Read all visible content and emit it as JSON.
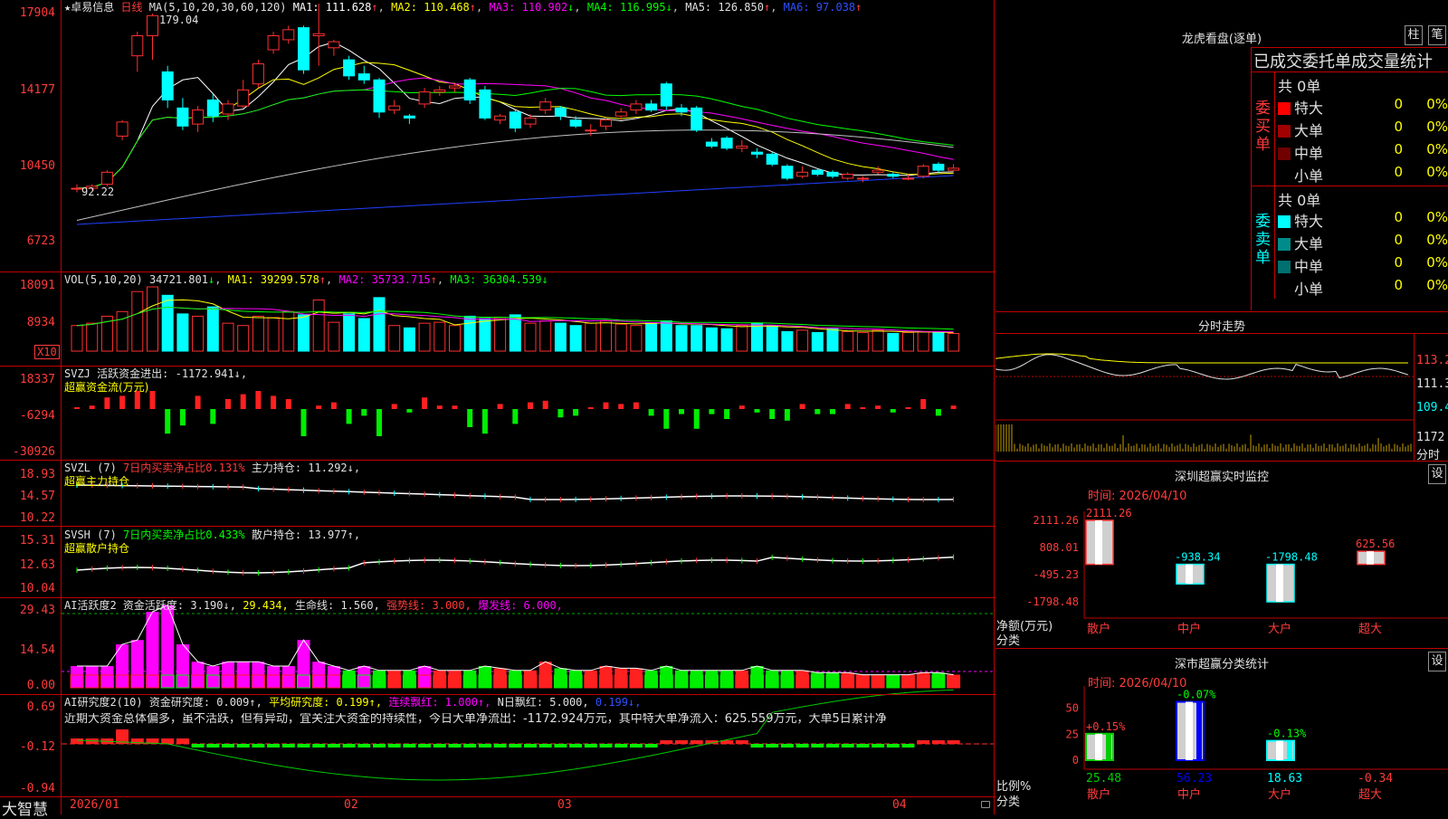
{
  "main_chart": {
    "star_mark": "★",
    "stock_name": "卓易信息",
    "period": "日线",
    "ma_legend": "MA(5,10,20,30,60,120)",
    "ma": [
      {
        "label": "MA1: 111.628",
        "arrow": "↑",
        "color": "#ffffff"
      },
      {
        "label": "MA2: 110.468",
        "arrow": "↑",
        "color": "#ffff00"
      },
      {
        "label": "MA3: 110.902",
        "arrow": "↓",
        "color": "#ff00ff"
      },
      {
        "label": "MA4: 116.995",
        "arrow": "↓",
        "color": "#00ff00"
      },
      {
        "label": "MA5: 126.850",
        "arrow": "↑",
        "color": "#c0c0c0"
      },
      {
        "label": "MA6: 97.038",
        "arrow": "↑",
        "color": "#3050ff"
      }
    ],
    "y_labels": [
      "17904",
      "14177",
      "10450",
      "6723"
    ],
    "high_annotation": "179.04",
    "low_annotation": "92.22",
    "candles": [
      {
        "o": 92,
        "c": 92,
        "h": 94,
        "l": 90
      },
      {
        "o": 92,
        "c": 93,
        "h": 94,
        "l": 91
      },
      {
        "o": 94,
        "c": 100,
        "h": 101,
        "l": 93
      },
      {
        "o": 118,
        "c": 125,
        "h": 126,
        "l": 116
      },
      {
        "o": 158,
        "c": 168,
        "h": 170,
        "l": 150
      },
      {
        "o": 168,
        "c": 178,
        "h": 179,
        "l": 156
      },
      {
        "o": 150,
        "c": 136,
        "h": 153,
        "l": 132
      },
      {
        "o": 132,
        "c": 123,
        "h": 137,
        "l": 121
      },
      {
        "o": 124,
        "c": 131,
        "h": 133,
        "l": 120
      },
      {
        "o": 136,
        "c": 128,
        "h": 139,
        "l": 125
      },
      {
        "o": 129,
        "c": 134,
        "h": 136,
        "l": 126
      },
      {
        "o": 133,
        "c": 141,
        "h": 146,
        "l": 132
      },
      {
        "o": 144,
        "c": 154,
        "h": 156,
        "l": 142
      },
      {
        "o": 161,
        "c": 168,
        "h": 170,
        "l": 159
      },
      {
        "o": 166,
        "c": 171,
        "h": 173,
        "l": 164
      },
      {
        "o": 172,
        "c": 151,
        "h": 173,
        "l": 149
      },
      {
        "o": 168,
        "c": 169,
        "h": 184,
        "l": 153
      },
      {
        "o": 162,
        "c": 165,
        "h": 166,
        "l": 158
      },
      {
        "o": 156,
        "c": 148,
        "h": 158,
        "l": 146
      },
      {
        "o": 149,
        "c": 146,
        "h": 153,
        "l": 144
      },
      {
        "o": 146,
        "c": 130,
        "h": 147,
        "l": 127
      },
      {
        "o": 131,
        "c": 133,
        "h": 136,
        "l": 129
      },
      {
        "o": 128,
        "c": 127,
        "h": 129,
        "l": 124
      },
      {
        "o": 134,
        "c": 140,
        "h": 142,
        "l": 132
      },
      {
        "o": 140,
        "c": 141,
        "h": 143,
        "l": 138
      },
      {
        "o": 142,
        "c": 143,
        "h": 144,
        "l": 140
      },
      {
        "o": 146,
        "c": 136,
        "h": 147,
        "l": 134
      },
      {
        "o": 141,
        "c": 127,
        "h": 143,
        "l": 126
      },
      {
        "o": 126,
        "c": 128,
        "h": 129,
        "l": 124
      },
      {
        "o": 130,
        "c": 122,
        "h": 131,
        "l": 120
      },
      {
        "o": 124,
        "c": 127,
        "h": 129,
        "l": 122
      },
      {
        "o": 131,
        "c": 135,
        "h": 137,
        "l": 129
      },
      {
        "o": 132,
        "c": 128,
        "h": 133,
        "l": 126
      },
      {
        "o": 126,
        "c": 123,
        "h": 128,
        "l": 122
      },
      {
        "o": 121,
        "c": 121,
        "h": 124,
        "l": 118
      },
      {
        "o": 123,
        "c": 126,
        "h": 127,
        "l": 121
      },
      {
        "o": 128,
        "c": 130,
        "h": 132,
        "l": 126
      },
      {
        "o": 131,
        "c": 134,
        "h": 136,
        "l": 129
      },
      {
        "o": 134,
        "c": 131,
        "h": 136,
        "l": 130
      },
      {
        "o": 144,
        "c": 133,
        "h": 145,
        "l": 131
      },
      {
        "o": 132,
        "c": 130,
        "h": 134,
        "l": 128
      },
      {
        "o": 132,
        "c": 121,
        "h": 133,
        "l": 120
      },
      {
        "o": 115,
        "c": 113,
        "h": 117,
        "l": 112
      },
      {
        "o": 117,
        "c": 112,
        "h": 118,
        "l": 111
      },
      {
        "o": 112,
        "c": 113,
        "h": 116,
        "l": 110
      },
      {
        "o": 110,
        "c": 109,
        "h": 112,
        "l": 107
      },
      {
        "o": 109,
        "c": 104,
        "h": 110,
        "l": 103
      },
      {
        "o": 103,
        "c": 97,
        "h": 104,
        "l": 96
      },
      {
        "o": 98,
        "c": 100,
        "h": 103,
        "l": 97
      },
      {
        "o": 101,
        "c": 99,
        "h": 102,
        "l": 98
      },
      {
        "o": 100,
        "c": 98,
        "h": 101,
        "l": 97
      },
      {
        "o": 97,
        "c": 99,
        "h": 100,
        "l": 96
      },
      {
        "o": 97,
        "c": 97,
        "h": 98,
        "l": 95
      },
      {
        "o": 100,
        "c": 101,
        "h": 103,
        "l": 99
      },
      {
        "o": 99,
        "c": 98,
        "h": 100,
        "l": 97
      },
      {
        "o": 97,
        "c": 97,
        "h": 99,
        "l": 96
      },
      {
        "o": 98,
        "c": 103,
        "h": 104,
        "l": 97
      },
      {
        "o": 104,
        "c": 101,
        "h": 105,
        "l": 100
      },
      {
        "o": 101,
        "c": 102,
        "h": 104,
        "l": 100
      }
    ]
  },
  "vol_panel": {
    "legend": "VOL(5,10,20)",
    "value": "34721.801",
    "value_arrow": "↓",
    "ma": [
      {
        "label": "MA1: 39299.578",
        "arrow": "↑",
        "color": "#ffff00"
      },
      {
        "label": "MA2: 35733.715",
        "arrow": "↑",
        "color": "#ff00ff"
      },
      {
        "label": "MA3: 36304.539",
        "arrow": "↓",
        "color": "#00ff00"
      }
    ],
    "y_labels": [
      "18091",
      "8934"
    ],
    "multiplier": "X10",
    "bars": [
      55,
      60,
      75,
      85,
      128,
      138,
      120,
      80,
      75,
      95,
      60,
      55,
      75,
      72,
      85,
      78,
      110,
      62,
      80,
      70,
      115,
      55,
      50,
      60,
      62,
      55,
      75,
      70,
      72,
      78,
      60,
      65,
      60,
      55,
      60,
      65,
      58,
      55,
      60,
      65,
      55,
      55,
      50,
      48,
      55,
      60,
      55,
      42,
      45,
      40,
      48,
      42,
      40,
      45,
      38,
      40,
      42,
      40,
      38
    ]
  },
  "svzj_panel": {
    "legend": "SVZJ",
    "desc": "活跃资金进出: -1172.941↓,",
    "sub": "超赢资金流(万元)",
    "y_labels": [
      "18337",
      "-6294",
      "-30926"
    ]
  },
  "svzl_panel": {
    "legend": "SVZL (7)",
    "desc1": "7日内买卖净占比0.131%",
    "desc2": "主力持仓: 11.292↓,",
    "sub": "超赢主力持仓",
    "y_labels": [
      "18.93",
      "14.57",
      "10.22"
    ]
  },
  "svsh_panel": {
    "legend": "SVSH (7)",
    "desc1": "7日内买卖净占比0.433%",
    "desc2": "散户持仓: 13.977↑,",
    "sub": "超赢散户持仓",
    "y_labels": [
      "15.31",
      "12.63",
      "10.04"
    ]
  },
  "ai1_panel": {
    "legend": "AI活跃度2",
    "p1": "资金活跃度: 3.190↓,",
    "p2": "29.434,",
    "p3": "生命线: 1.560,",
    "p4": "强势线: 3.000,",
    "p5": "爆发线: 6.000,",
    "y_labels": [
      "29.43",
      "14.54",
      "0.00"
    ]
  },
  "ai2_panel": {
    "legend": "AI研究度2(10)",
    "p1": "资金研究度: 0.009↑,",
    "p2": "平均研究度: 0.199↑,",
    "p3": "连续飘红: 1.000↑,",
    "p4": "N日飘红: 5.000,",
    "p5": "0.199↓,",
    "commentary": "近期大资金总体偏多，虽不活跃，但有异动，宜关注大资金的持续性，今日大单净流出：-1172.924万元，其中特大单净流入：625.559万元，大单5日累计净",
    "y_labels": [
      "0.69",
      "-0.12",
      "-0.94"
    ]
  },
  "x_axis": {
    "brand": "大智慧",
    "labels": [
      "2026/01",
      "02",
      "03",
      "04"
    ]
  },
  "longhu": {
    "title": "龙虎看盘(逐单)",
    "btn1": "柱",
    "btn2": "笔",
    "header": "已成交委托单成交量统计",
    "buy_label": "委买单",
    "sell_label": "委卖单",
    "buy_total": "共 0单",
    "sell_total": "共 0单",
    "buy_rows": [
      {
        "name": "特大",
        "color": "#ff0000",
        "v": "0",
        "p": "0%"
      },
      {
        "name": "大单",
        "color": "#a00000",
        "v": "0",
        "p": "0%"
      },
      {
        "name": "中单",
        "color": "#700000",
        "v": "0",
        "p": "0%"
      },
      {
        "name": "小单",
        "color": "#000000",
        "v": "0",
        "p": "0%"
      }
    ],
    "sell_rows": [
      {
        "name": "特大",
        "color": "#00ffff",
        "v": "0",
        "p": "0%"
      },
      {
        "name": "大单",
        "color": "#008b8b",
        "v": "0",
        "p": "0%"
      },
      {
        "name": "中单",
        "color": "#007070",
        "v": "0",
        "p": "0%"
      },
      {
        "name": "小单",
        "color": "#000000",
        "v": "0",
        "p": "0%"
      }
    ]
  },
  "fenshi": {
    "title": "分时走势",
    "y_labels": [
      "113.2",
      "111.3",
      "109.4",
      "1172"
    ],
    "bottom_label": "分时"
  },
  "sz_monitor": {
    "title": "深圳超赢实时监控",
    "btn": "设",
    "time": "时间: 2026/04/10",
    "y_labels": [
      "2111.26",
      "808.01",
      "-495.23",
      "-1798.48"
    ],
    "ylabel1": "净额(万元)",
    "ylabel2": "分类",
    "bars": [
      {
        "cat": "散户",
        "value": 2111.26,
        "label": "2111.26",
        "label_color": "#ff3b3b"
      },
      {
        "cat": "中户",
        "value": -938.34,
        "label": "-938.34",
        "label_color": "#00ffff"
      },
      {
        "cat": "大户",
        "value": -1798.48,
        "label": "-1798.48",
        "label_color": "#00ffff"
      },
      {
        "cat": "超大",
        "value": 625.56,
        "label": "625.56",
        "label_color": "#ff3b3b"
      }
    ]
  },
  "sz_class": {
    "title": "深市超赢分类统计",
    "btn": "设",
    "time": "时间: 2026/04/10",
    "y_labels": [
      "75",
      "50",
      "25",
      "0"
    ],
    "ylabel1": "比例%",
    "ylabel2": "分类",
    "bars": [
      {
        "cat": "散户",
        "value": 25.48,
        "label": "25.48",
        "top": "+0.15%",
        "top_color": "#ff3b3b",
        "bar_color": "#00cc00"
      },
      {
        "cat": "中户",
        "value": 56.23,
        "label": "56.23",
        "top": "-0.07%",
        "top_color": "#00ff00",
        "bar_color": "#0000ff"
      },
      {
        "cat": "大户",
        "value": 18.63,
        "label": "18.63",
        "top": "-0.13%",
        "top_color": "#00ff00",
        "bar_color": "#00ffff"
      },
      {
        "cat": "超大",
        "value": -0.34,
        "label": "-0.34",
        "top": "",
        "top_color": "#ff3b3b",
        "bar_color": "#ff0000"
      }
    ]
  }
}
